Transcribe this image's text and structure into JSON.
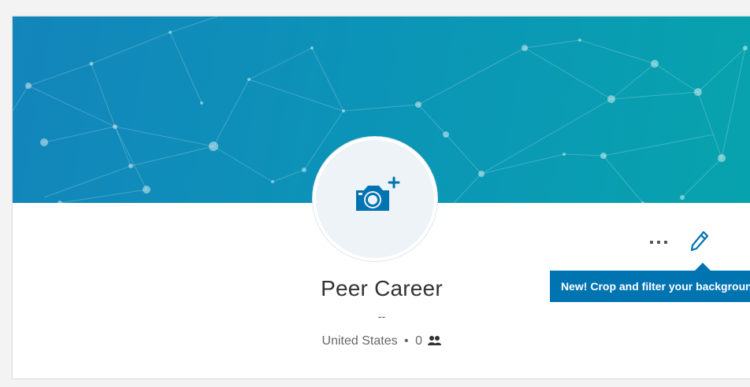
{
  "profile": {
    "name": "Peer Career",
    "headline": "--",
    "location": "United States",
    "separator": "•",
    "connections_count": "0"
  },
  "tooltip": {
    "text": "New! Crop and filter your background"
  },
  "icons": {
    "camera": "camera-add-icon",
    "more": "more-horizontal-icon",
    "edit": "pencil-icon",
    "connections": "people-icon"
  },
  "colors": {
    "banner_start": "#1385bb",
    "banner_end": "#07a3ad",
    "accent": "#0073b1"
  }
}
